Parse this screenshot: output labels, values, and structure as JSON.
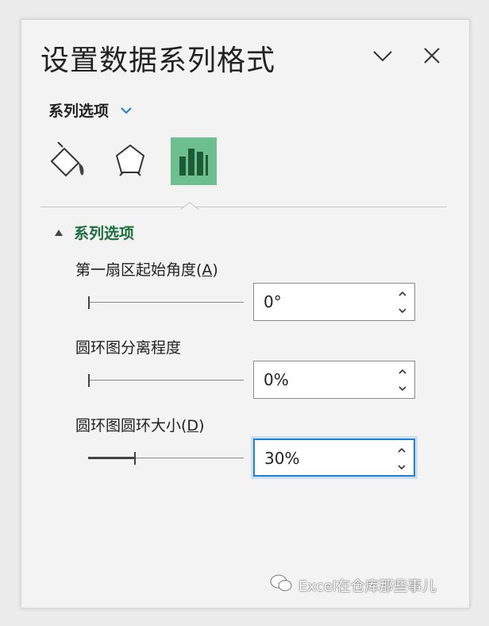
{
  "pane": {
    "title": "设置数据系列格式",
    "options_label": "系列选项",
    "section_label": "系列选项"
  },
  "icons": {
    "collapse": "chevron-down-icon",
    "close": "close-icon",
    "fill_line": "paint-bucket-icon",
    "effects": "pentagon-icon",
    "series_options": "bar-chart-icon"
  },
  "colors": {
    "active_tab": "#6dbf8f",
    "section_text": "#1e6e3e",
    "focus_border": "#1f82d8"
  },
  "fields": [
    {
      "label": "第一扇区起始角度(",
      "key": "A",
      "label_end": ")",
      "value": "0°",
      "slider_value": 0
    },
    {
      "label": "圆环图分离程度",
      "key": "",
      "label_end": "",
      "value": "0%",
      "slider_value": 0
    },
    {
      "label": "圆环图圆环大小(",
      "key": "D",
      "label_end": ")",
      "value": "30%",
      "slider_value": 0.3
    }
  ],
  "watermark": "Excel在仓库那些事儿"
}
